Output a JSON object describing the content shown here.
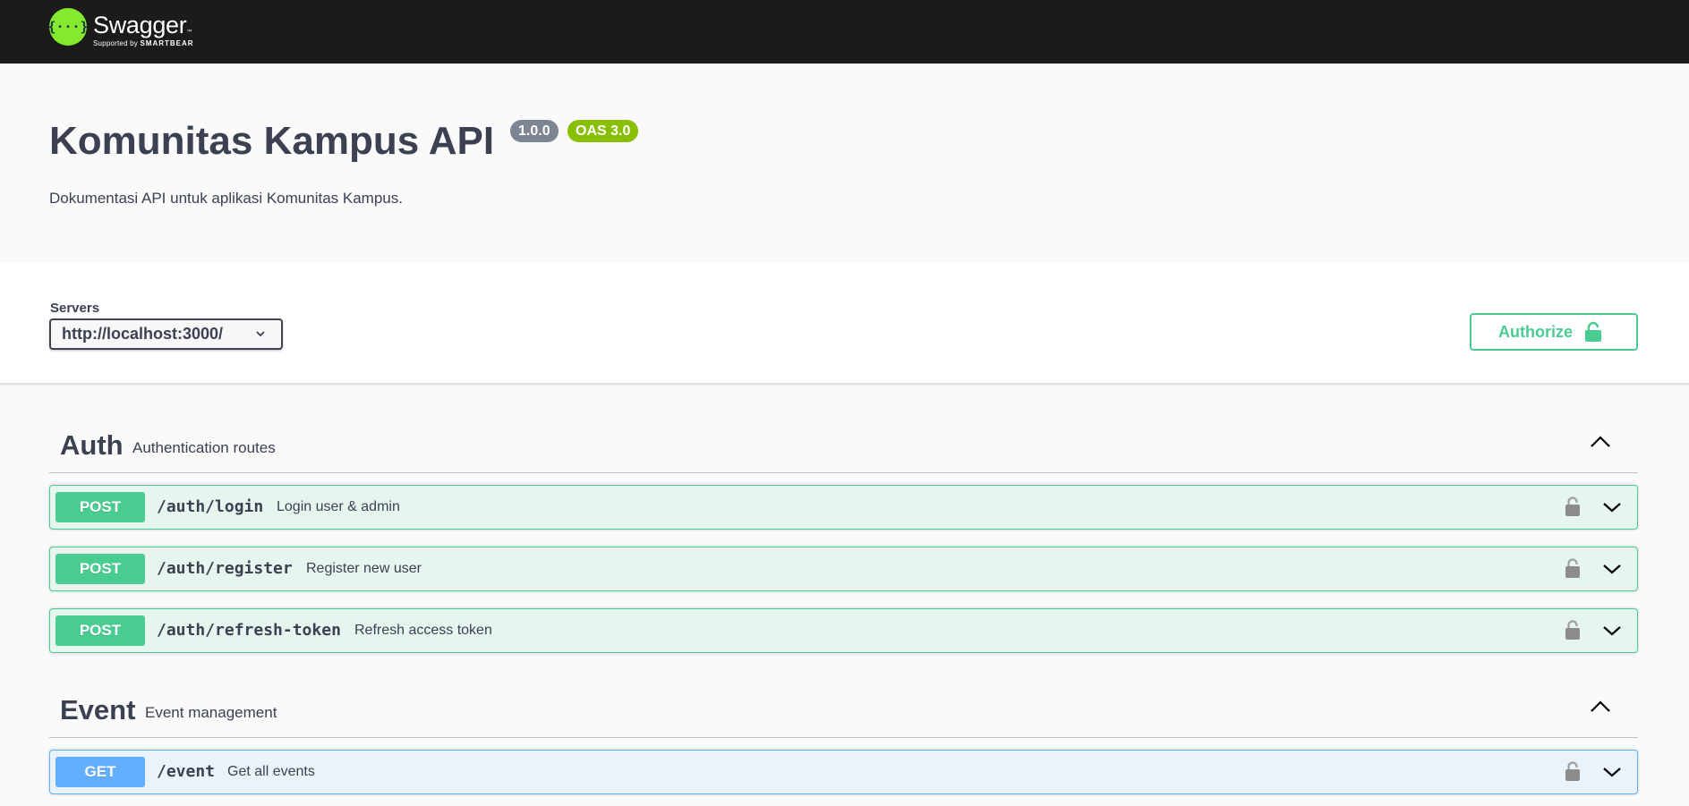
{
  "topbar": {
    "logo_glyph": "{···}",
    "logo_name": "Swagger",
    "logo_tm": "™",
    "logo_sub_prefix": "Supported by",
    "logo_sub_brand": "SMARTBEAR"
  },
  "info": {
    "title": "Komunitas Kampus API",
    "version": "1.0.0",
    "oas": "OAS 3.0",
    "description": "Dokumentasi API untuk aplikasi Komunitas Kampus."
  },
  "servers": {
    "label": "Servers",
    "selected": "http://localhost:3000/"
  },
  "authorize": {
    "label": "Authorize"
  },
  "tags": [
    {
      "name": "Auth",
      "description": "Authentication routes",
      "operations": [
        {
          "method": "POST",
          "path": "/auth/login",
          "summary": "Login user & admin"
        },
        {
          "method": "POST",
          "path": "/auth/register",
          "summary": "Register new user"
        },
        {
          "method": "POST",
          "path": "/auth/refresh-token",
          "summary": "Refresh access token"
        }
      ]
    },
    {
      "name": "Event",
      "description": "Event management",
      "operations": [
        {
          "method": "GET",
          "path": "/event",
          "summary": "Get all events"
        }
      ]
    }
  ],
  "colors": {
    "post": "#49cc90",
    "get": "#61affe",
    "topbar": "#1b1b1b",
    "logo": "#85ea2d"
  },
  "icons": {
    "authorize": "unlocked-padlock-icon",
    "operation_lock": "padlock-icon",
    "expand": "chevron-down-icon",
    "collapse": "chevron-up-icon"
  }
}
